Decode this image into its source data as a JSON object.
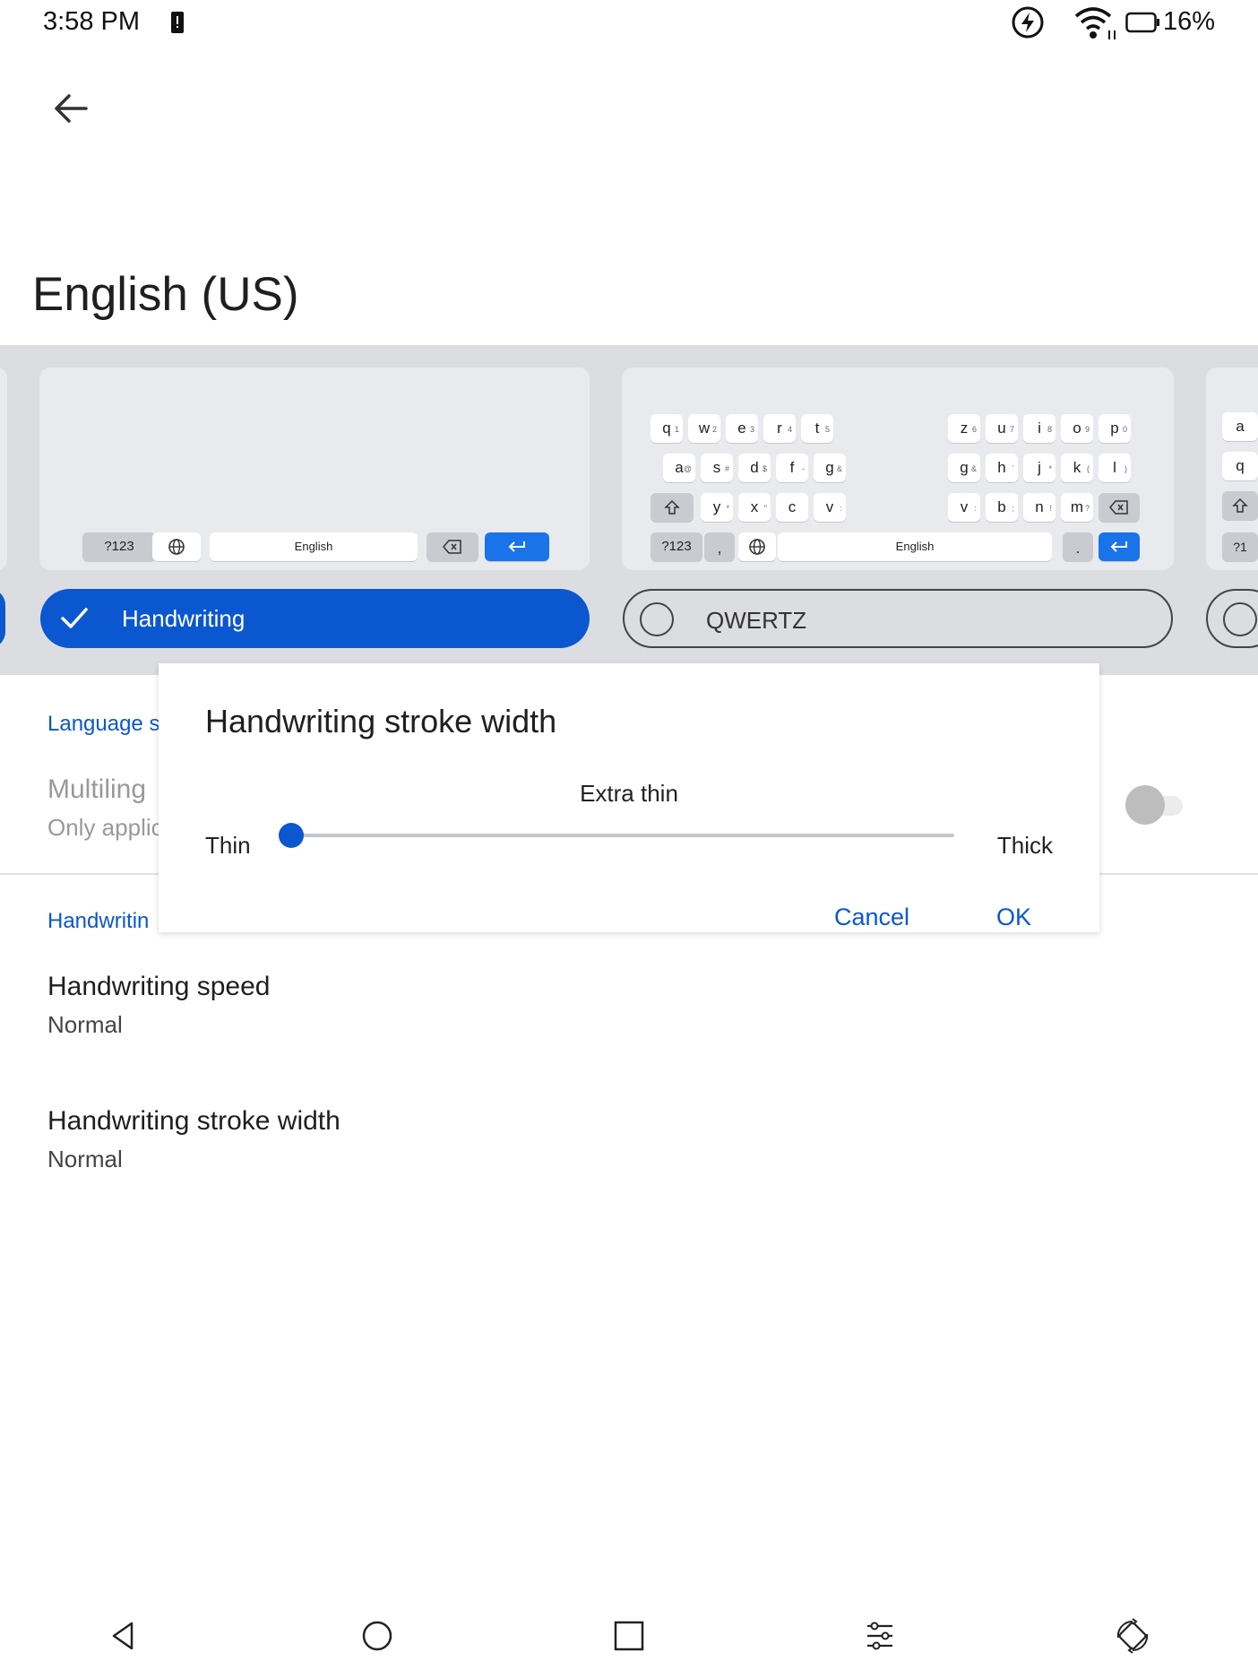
{
  "status_bar": {
    "time": "3:58 PM",
    "battery_percent": "16%",
    "icons": [
      "sim-alert-icon",
      "data-saver-icon",
      "wifi-icon",
      "battery-icon"
    ]
  },
  "header": {
    "back_icon": "arrow-left-icon",
    "title": "English (US)"
  },
  "layouts": {
    "selected_label": "Handwriting",
    "unselected_label": "QWERTZ",
    "handwriting_preview": {
      "keys": {
        "num": "?123",
        "space": "English"
      }
    },
    "qwertz_preview": {
      "row1_left": [
        [
          "q",
          "1"
        ],
        [
          "w",
          "2"
        ],
        [
          "e",
          "3"
        ],
        [
          "r",
          "4"
        ],
        [
          "t",
          "5"
        ]
      ],
      "row1_right": [
        [
          "z",
          "6"
        ],
        [
          "u",
          "7"
        ],
        [
          "i",
          "8"
        ],
        [
          "o",
          "9"
        ],
        [
          "p",
          "0"
        ]
      ],
      "row2_left": [
        [
          "a",
          "@"
        ],
        [
          "s",
          "#"
        ],
        [
          "d",
          "$"
        ],
        [
          "f",
          "-"
        ],
        [
          "g",
          "&"
        ]
      ],
      "row2_right": [
        [
          "g",
          "&"
        ],
        [
          "h",
          "`"
        ],
        [
          "j",
          "*"
        ],
        [
          "k",
          "("
        ],
        [
          "l",
          ")"
        ]
      ],
      "row3_left": [
        [
          "y",
          "*"
        ],
        [
          "x",
          "\""
        ],
        [
          "c",
          ""
        ],
        [
          "v",
          ":"
        ]
      ],
      "row3_right": [
        [
          "v",
          ":"
        ],
        [
          "b",
          ";"
        ],
        [
          "n",
          "!"
        ],
        [
          "m",
          "?"
        ]
      ],
      "bottom": {
        "num": "?123",
        "comma": ",",
        "space": "English",
        "period": "."
      }
    },
    "peek_right_keys": [
      "a",
      "q",
      "?1"
    ]
  },
  "settings": {
    "section_language": "Language s",
    "multilingual_title": "Multiling",
    "multilingual_sub": "Only applic",
    "section_handwriting": "Handwritin",
    "speed_title": "Handwriting speed",
    "speed_value": "Normal",
    "stroke_title": "Handwriting stroke width",
    "stroke_value": "Normal"
  },
  "dialog": {
    "title": "Handwriting stroke width",
    "current_value": "Extra thin",
    "min_label": "Thin",
    "max_label": "Thick",
    "slider_fraction": 0.0,
    "cancel_label": "Cancel",
    "ok_label": "OK"
  },
  "nav_bar": {
    "icons": [
      "back-triangle-icon",
      "home-circle-icon",
      "recents-square-icon",
      "sliders-icon",
      "rotate-icon"
    ]
  },
  "colors": {
    "accent": "#0b57d0",
    "enter_key": "#1a73e8",
    "strip_bg": "#dcdde0"
  }
}
